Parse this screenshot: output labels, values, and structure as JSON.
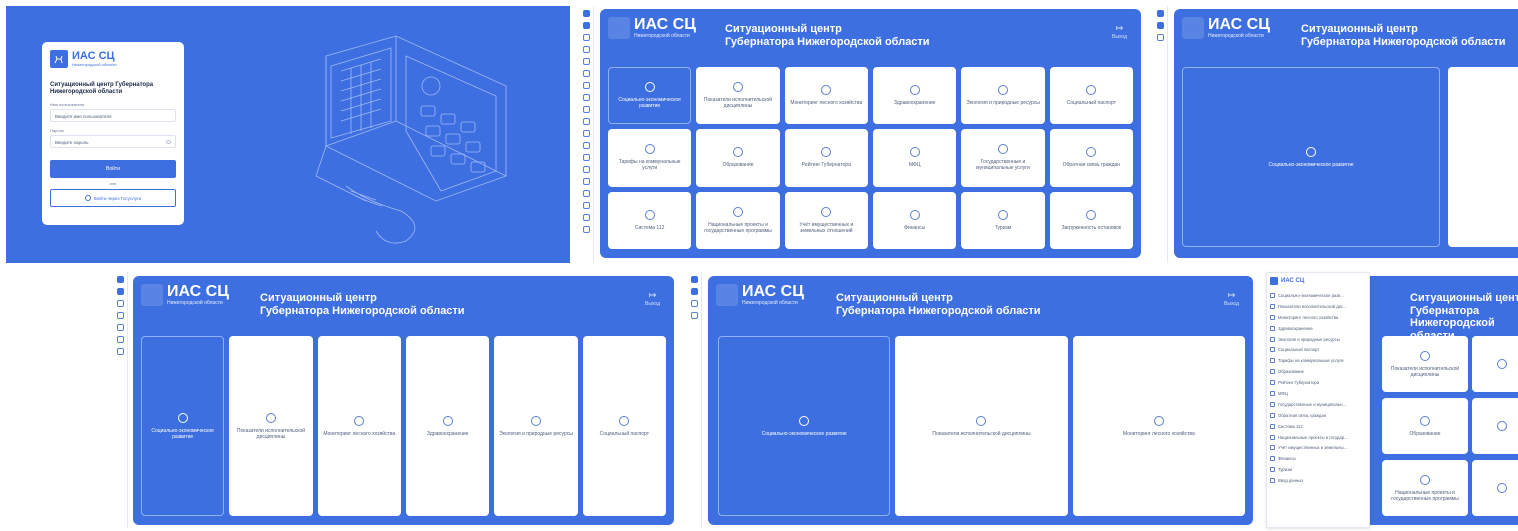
{
  "brand": {
    "name": "ИАС СЦ",
    "region": "Нижегородской области"
  },
  "login": {
    "title": "Ситуационный центр Губернатора Нижегородской области",
    "username_label": "Имя пользователя",
    "username_placeholder": "Введите имя пользователя",
    "password_label": "Пароль",
    "password_placeholder": "Введите пароль",
    "submit_label": "Войти",
    "or_label": "или",
    "gosuslugi_label": "Войти через Госуслуги"
  },
  "dashboard": {
    "title_line1": "Ситуационный центр",
    "title_line2": "Губернатора Нижегородской области",
    "exit_label": "Выход",
    "tiles": [
      "Социально-экономическое развитие",
      "Показатели исполнительской дисциплины",
      "Мониторинг лесного хозяйства",
      "Здравоохранение",
      "Экология и природные ресурсы",
      "Социальный паспорт",
      "Тарифы на коммунальные услуги",
      "Образование",
      "Рейтинг Губернатора",
      "МФЦ",
      "Государственные и муниципальные услуги",
      "Обратная связь граждан",
      "Система 112",
      "Национальные проекты и государственные программы",
      "Учёт имущественных и земельных отношений",
      "Финансы",
      "Туризм",
      "Загруженность остановок"
    ]
  },
  "menu": {
    "items": [
      "Социально-экономическое разв...",
      "Показатели исполнительской дис...",
      "Мониторинг лесного хозяйства",
      "Здравоохранение",
      "Экология и природные ресурсы",
      "Социальный паспорт",
      "Тарифы на коммунальные услуги",
      "Образование",
      "Рейтинг Губернатора",
      "МФЦ",
      "Государственные и муниципальн...",
      "Обратная связь граждан",
      "Система 112",
      "Национальные проекты и государ...",
      "Учёт имущественных и земельны...",
      "Финансы",
      "Туризм",
      "Ввод данных"
    ]
  },
  "colors": {
    "accent": "#3d6fe0",
    "white": "#ffffff"
  }
}
